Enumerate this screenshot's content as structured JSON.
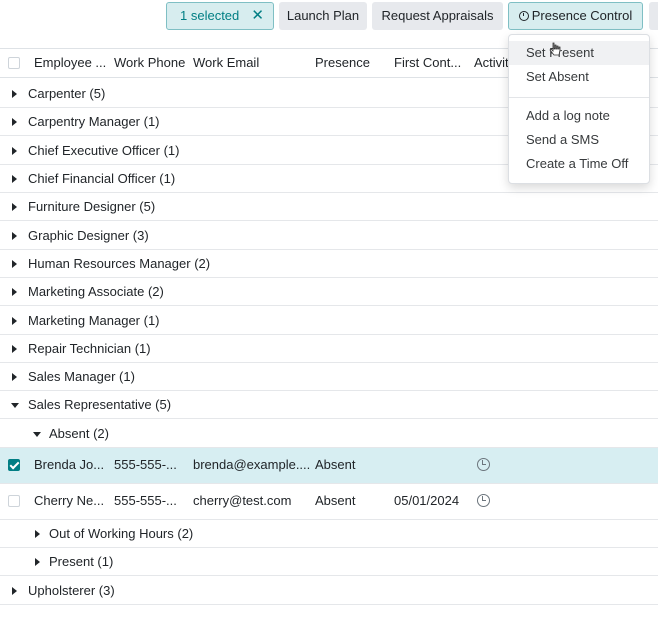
{
  "toolbar": {
    "selected_label": "1 selected",
    "clear_label": "✕",
    "launch_plan": "Launch Plan",
    "request_appraisals": "Request Appraisals",
    "presence_control": "Presence Control"
  },
  "columns": {
    "employee": "Employee ...",
    "work_phone": "Work Phone",
    "work_email": "Work Email",
    "presence": "Presence",
    "first_contact": "First Cont...",
    "activities": "Activit"
  },
  "groups": [
    {
      "label": "Carpenter (5)"
    },
    {
      "label": "Carpentry Manager (1)"
    },
    {
      "label": "Chief Executive Officer (1)"
    },
    {
      "label": "Chief Financial Officer (1)"
    },
    {
      "label": "Furniture Designer (5)"
    },
    {
      "label": "Graphic Designer (3)"
    },
    {
      "label": "Human Resources Manager (2)"
    },
    {
      "label": "Marketing Associate (2)"
    },
    {
      "label": "Marketing Manager (1)"
    },
    {
      "label": "Repair Technician (1)"
    },
    {
      "label": "Sales Manager (1)"
    },
    {
      "label": "Sales Representative (5)"
    }
  ],
  "subgroups": {
    "absent": "Absent (2)",
    "out_of_hours": "Out of Working Hours (2)",
    "present": "Present (1)"
  },
  "records": [
    {
      "name": "Brenda Jo...",
      "phone": "555-555-...",
      "email": "brenda@example....",
      "presence": "Absent",
      "first_contact": "",
      "checked": true
    },
    {
      "name": "Cherry Ne...",
      "phone": "555-555-...",
      "email": "cherry@test.com",
      "presence": "Absent",
      "first_contact": "05/01/2024",
      "checked": false
    }
  ],
  "last_group": "Upholsterer (3)",
  "dropdown": {
    "set_present": "Set Present",
    "set_absent": "Set Absent",
    "add_log_note": "Add a log note",
    "send_sms": "Send a SMS",
    "create_time_off": "Create a Time Off"
  },
  "colors": {
    "accent": "#017e84",
    "selected_row": "#d7eef2"
  }
}
